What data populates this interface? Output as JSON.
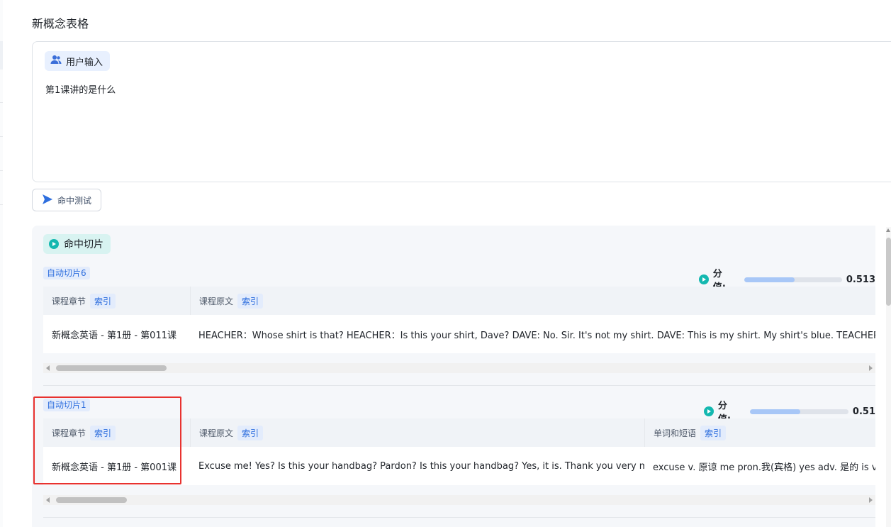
{
  "page": {
    "title": "新概念表格"
  },
  "input_card": {
    "tag_label": "用户输入",
    "tag_icon": "users-icon",
    "query": "第1课讲的是什么"
  },
  "hit_test_button": {
    "label": "命中测试",
    "icon": "send-icon"
  },
  "results": {
    "tag_label": "命中切片",
    "tag_icon": "play-circle-icon",
    "score_label": "分值:",
    "slices": [
      {
        "tag": "自动切片6",
        "score": "0.513",
        "score_fraction": 0.513,
        "columns": [
          {
            "header": "课程章节",
            "index_label": "索引",
            "value": "新概念英语 - 第1册 - 第011课"
          },
          {
            "header": "课程原文",
            "index_label": "索引",
            "value": "HEACHER：Whose shirt is that? HEACHER：Is this your shirt, Dave? DAVE: No. Sir. It's not my shirt. DAVE: This is my shirt. My shirt's blue. TEACHER: Is this shirt Tim's? Perhaps it is, sir. Tim's shirt's white."
          }
        ]
      },
      {
        "tag": "自动切片1",
        "score": "0.51",
        "score_fraction": 0.51,
        "columns": [
          {
            "header": "课程章节",
            "index_label": "索引",
            "value": "新概念英语 - 第1册 - 第001课"
          },
          {
            "header": "课程原文",
            "index_label": "索引",
            "value": "Excuse me! Yes? Is this your handbag? Pardon? Is this your handbag? Yes, it is. Thank you very much."
          },
          {
            "header": "单词和短语",
            "index_label": "索引",
            "value": "excuse v. 原谅 me pron.我(宾格) yes adv. 是的 is v. 动词现在时第三人称单数"
          }
        ]
      }
    ]
  },
  "colors": {
    "accent_blue": "#2f6fde",
    "teal": "#14b8b0",
    "highlight_red": "#e8322f"
  }
}
